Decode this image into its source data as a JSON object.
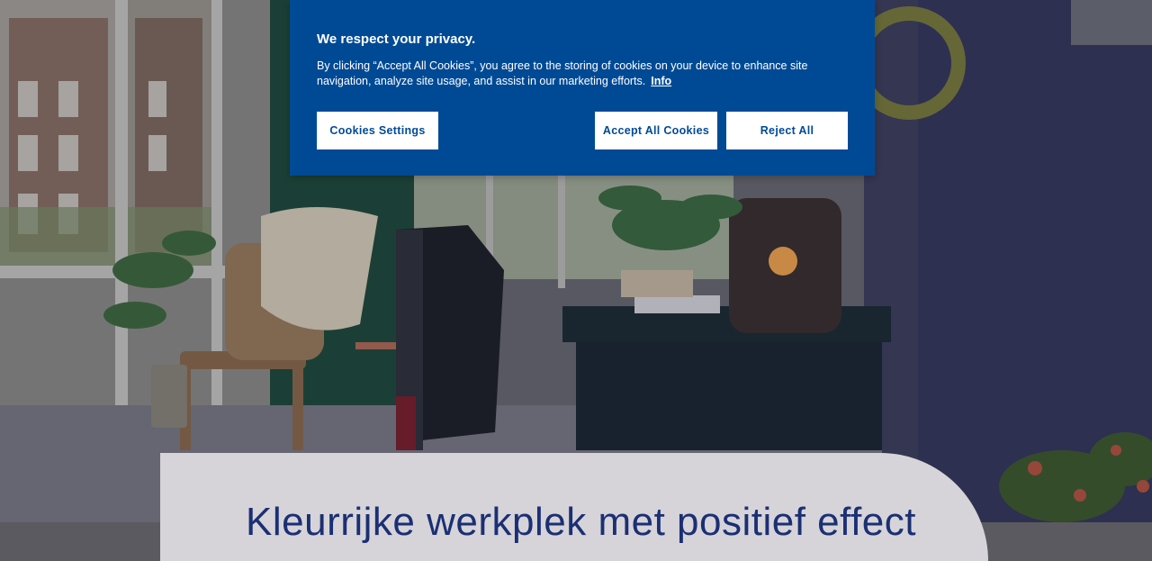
{
  "cookie_banner": {
    "title": "We respect your privacy.",
    "text": "By clicking “Accept All Cookies”, you agree to the storing of cookies on your device to enhance site navigation, analyze site usage, and assist in our marketing efforts.",
    "info_link": "Info",
    "settings_button": "Cookies Settings",
    "accept_button": "Accept All Cookies",
    "reject_button": "Reject All"
  },
  "hero": {
    "title": "Kleurrijke werkplek met positief effect"
  },
  "colors": {
    "banner_bg": "#004a95",
    "button_text": "#004a95",
    "hero_title": "#1b2f74",
    "hero_card": "#d6d4d8"
  }
}
